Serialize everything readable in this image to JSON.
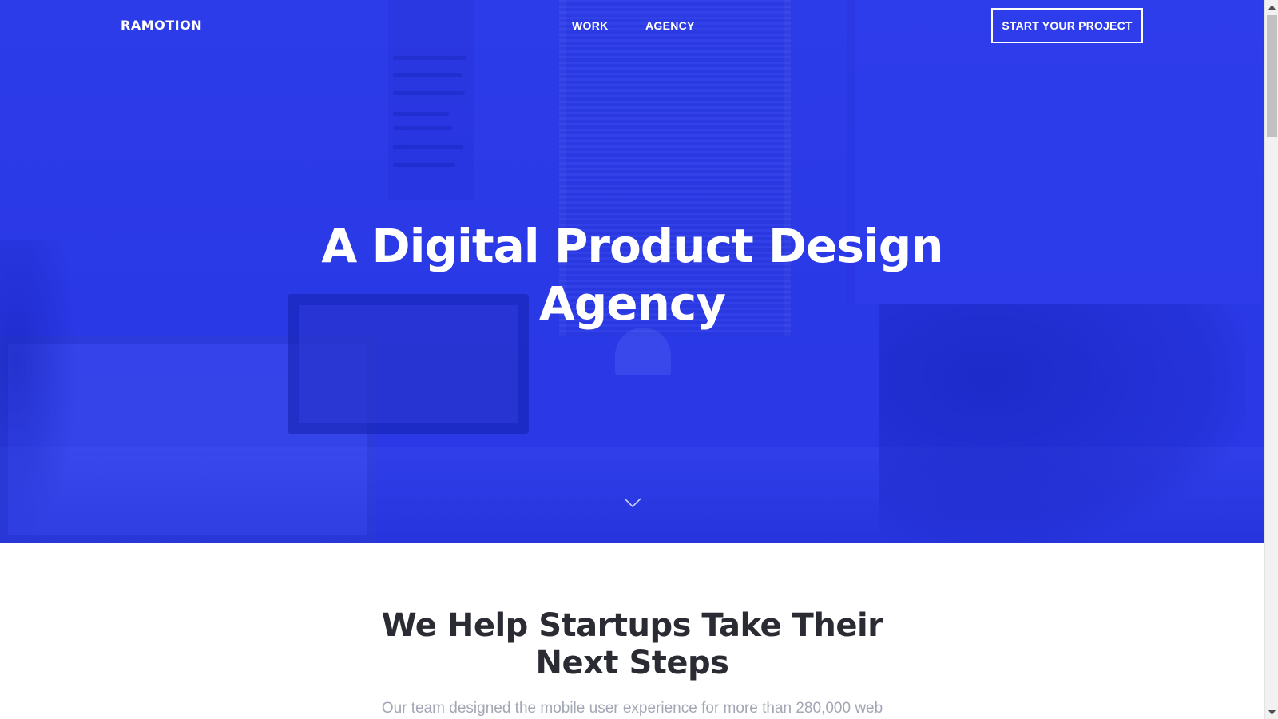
{
  "nav": {
    "logo": "RAMOTION",
    "links": [
      {
        "label": "WORK"
      },
      {
        "label": "AGENCY"
      }
    ],
    "cta_label": "START YOUR PROJECT"
  },
  "hero": {
    "title_line1": "A Digital Product Design",
    "title_line2": "Agency",
    "accent_color": "#2d3ce5",
    "scroll_icon": "chevron-down-icon"
  },
  "section": {
    "title_line1": "We Help Startups Take Their",
    "title_line2": "Next Steps",
    "text": "Our team designed the mobile user experience for more than 280,000 web"
  },
  "scrollbar": {
    "up_icon": "scroll-up-arrow-icon",
    "down_icon": "scroll-down-arrow-icon"
  }
}
